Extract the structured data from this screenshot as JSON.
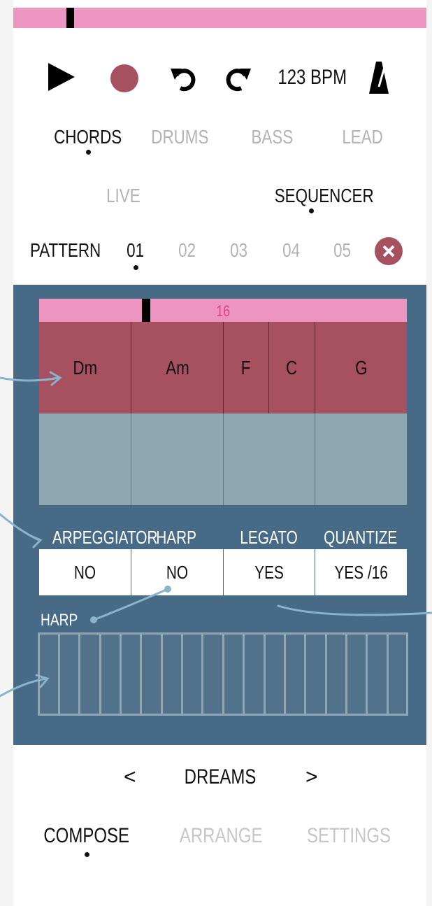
{
  "colors": {
    "pink": "#ec95c0",
    "panel": "#476b86",
    "chord": "#a75160",
    "record": "#a75160"
  },
  "transport": {
    "play_icon": "play-icon",
    "record_icon": "record-icon",
    "undo_icon": "undo-icon",
    "redo_icon": "redo-icon",
    "bpm": "123 BPM",
    "metronome_icon": "metronome-icon"
  },
  "instrument_tabs": [
    {
      "label": "CHORDS",
      "active": true
    },
    {
      "label": "DRUMS",
      "active": false
    },
    {
      "label": "BASS",
      "active": false
    },
    {
      "label": "LEAD",
      "active": false
    }
  ],
  "mode_tabs": [
    {
      "label": "LIVE",
      "active": false
    },
    {
      "label": "SEQUENCER",
      "active": true
    }
  ],
  "pattern": {
    "label": "PATTERN",
    "items": [
      {
        "label": "01",
        "active": true
      },
      {
        "label": "02",
        "active": false
      },
      {
        "label": "03",
        "active": false
      },
      {
        "label": "04",
        "active": false
      },
      {
        "label": "05",
        "active": false
      }
    ],
    "close_icon": "close-icon"
  },
  "sequencer": {
    "steps_label": "16",
    "chords": [
      "Dm",
      "Am",
      "F",
      "C",
      "G"
    ]
  },
  "options": {
    "labels": [
      "ARPEGGIATOR",
      "HARP",
      "LEGATO",
      "QUANTIZE"
    ],
    "values": [
      "NO",
      "NO",
      "YES",
      "YES /16"
    ]
  },
  "harp": {
    "label": "HARP"
  },
  "song": {
    "prev": "<",
    "name": "DREAMS",
    "next": ">"
  },
  "bottom_tabs": [
    {
      "label": "COMPOSE",
      "active": true
    },
    {
      "label": "ARRANGE",
      "active": false
    },
    {
      "label": "SETTINGS",
      "active": false
    }
  ]
}
